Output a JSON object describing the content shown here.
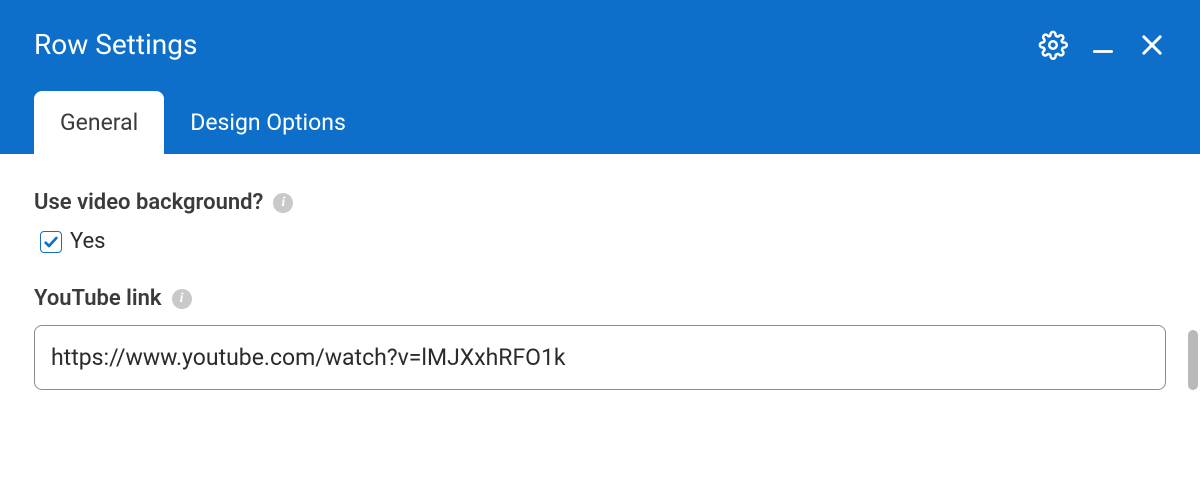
{
  "header": {
    "title": "Row Settings"
  },
  "tabs": [
    {
      "label": "General",
      "active": true
    },
    {
      "label": "Design Options",
      "active": false
    }
  ],
  "fields": {
    "video_bg": {
      "label": "Use video background?",
      "checked": true,
      "option_label": "Yes"
    },
    "youtube": {
      "label": "YouTube link",
      "value": "https://www.youtube.com/watch?v=lMJXxhRFO1k"
    }
  }
}
